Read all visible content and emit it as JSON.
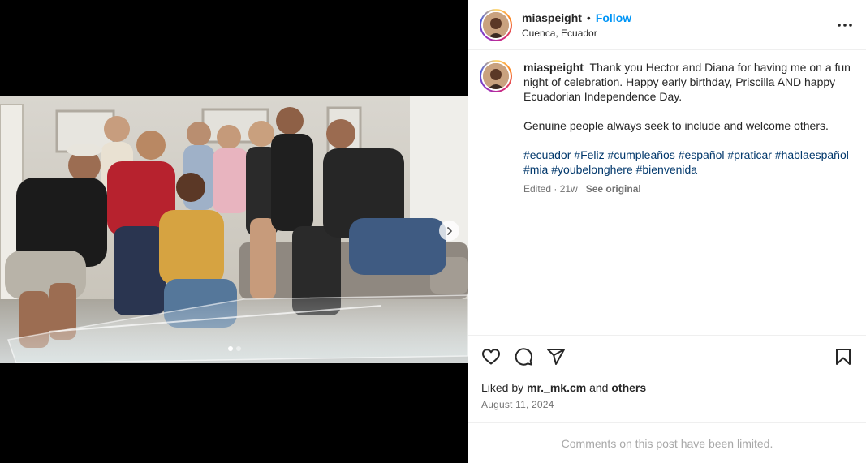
{
  "post": {
    "username": "miaspeight",
    "separator": "•",
    "follow_label": "Follow",
    "location": "Cuenca, Ecuador"
  },
  "caption": {
    "username": "miaspeight",
    "text": "Thank you Hector and Diana for having me on a fun night of celebration. Happy early birthday, Priscilla AND happy Ecuadorian Independence Day.",
    "text2": "Genuine people always seek to include and welcome others.",
    "hashtags": [
      "#ecuador",
      "#Feliz",
      "#cumpleaños",
      "#español",
      "#praticar",
      "#hablaespañol",
      "#mia",
      "#youbelonghere",
      "#bienvenida"
    ],
    "edited": "Edited · 21w",
    "see_original": "See original"
  },
  "engagement": {
    "liked_by_prefix": "Liked by",
    "liked_by_user": "mr._mk.cm",
    "and_word": "and",
    "others": "others",
    "date": "August 11, 2024"
  },
  "footer": {
    "comments_limited": "Comments on this post have been limited."
  },
  "carousel": {
    "slide_count": 2,
    "active_index": 0
  },
  "icons": {
    "more": "more-options-icon",
    "like": "heart-icon",
    "comment": "comment-icon",
    "share": "send-icon",
    "save": "bookmark-icon",
    "next": "chevron-right-icon"
  },
  "colors": {
    "follow": "#0095f6",
    "hashtag": "#00376b",
    "muted": "#737373"
  }
}
